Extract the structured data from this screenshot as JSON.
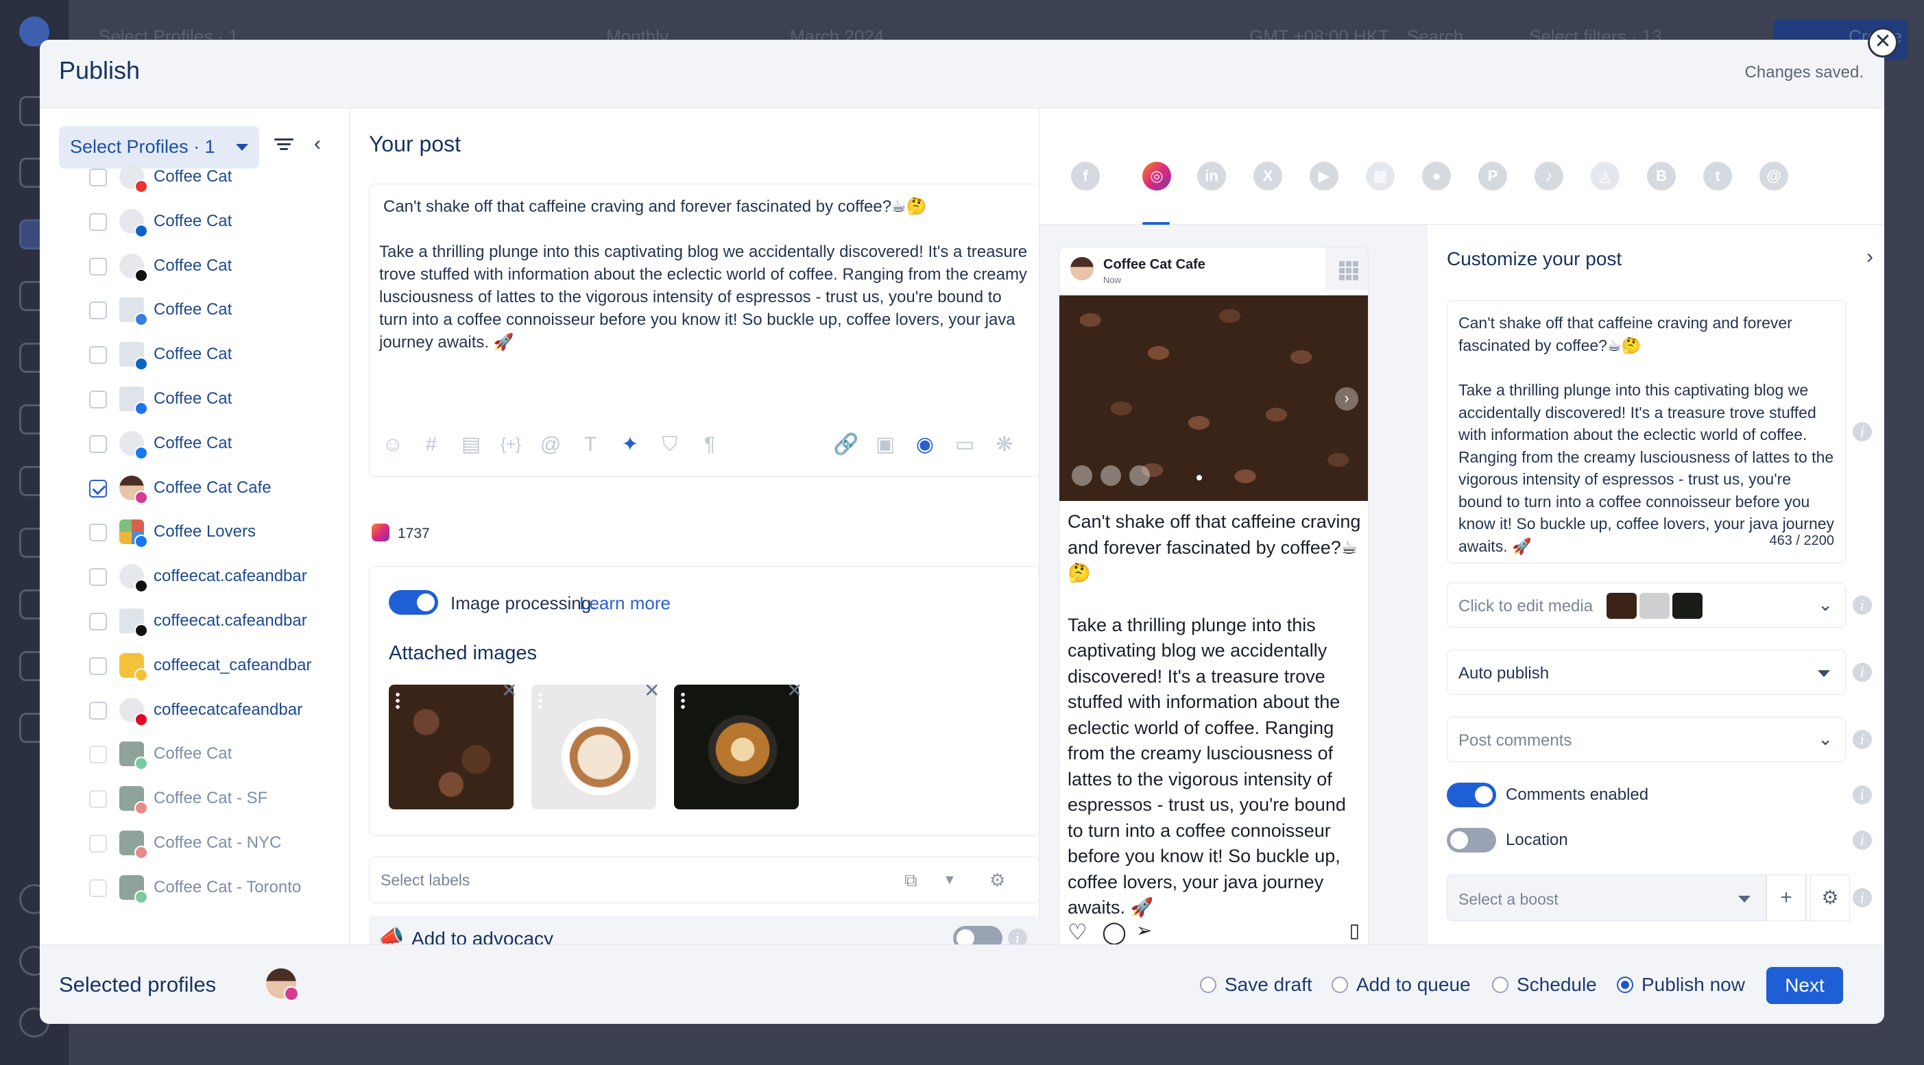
{
  "background": {
    "profiles_label": "Select Profiles · 1",
    "period": "Monthly",
    "month": "March 2024",
    "timezone": "GMT +08:00 HKT",
    "search": "Search",
    "filters": "Select filters · 13",
    "create": "Create"
  },
  "modal": {
    "title": "Publish",
    "status": "Changes saved.",
    "close_icon": "✕"
  },
  "profiles": {
    "select_label": "Select Profiles · 1",
    "items": [
      {
        "name": "Coffee Cat",
        "icon": "youtube",
        "badge_color": "#e5352e",
        "checked": false
      },
      {
        "name": "Coffee Cat",
        "icon": "linkedin",
        "badge_color": "#0a66c2",
        "checked": false
      },
      {
        "name": "Coffee Cat",
        "icon": "x",
        "badge_color": "#111111",
        "checked": false
      },
      {
        "name": "Coffee Cat",
        "icon": "google-business",
        "badge_color": "#3b7ddd",
        "checked": false
      },
      {
        "name": "Coffee Cat",
        "icon": "linkedin-page",
        "badge_color": "#0a66c2",
        "checked": false
      },
      {
        "name": "Coffee Cat",
        "icon": "bluesky",
        "badge_color": "#1d74e8",
        "checked": false
      },
      {
        "name": "Coffee Cat",
        "icon": "facebook",
        "badge_color": "#1877f2",
        "checked": false
      },
      {
        "name": "Coffee Cat Cafe",
        "icon": "instagram",
        "badge_color": "#d63b8f",
        "checked": true
      },
      {
        "name": "Coffee Lovers",
        "icon": "facebook",
        "badge_color": "#1877f2",
        "checked": false
      },
      {
        "name": "coffeecat.cafeandbar",
        "icon": "tiktok",
        "badge_color": "#111111",
        "checked": false
      },
      {
        "name": "coffeecat.cafeandbar",
        "icon": "threads",
        "badge_color": "#111111",
        "checked": false
      },
      {
        "name": "coffeecat_cafeandbar",
        "icon": "snapchat",
        "badge_color": "#f4c23a",
        "checked": false
      },
      {
        "name": "coffeecatcafeandbar",
        "icon": "pinterest",
        "badge_color": "#e60023",
        "checked": false
      },
      {
        "name": "Coffee Cat",
        "icon": "google-business",
        "badge_color": "#7ccaa0",
        "checked": false,
        "dim": true
      },
      {
        "name": "Coffee Cat - SF",
        "icon": "yelp",
        "badge_color": "#e88a8a",
        "checked": false,
        "dim": true
      },
      {
        "name": "Coffee Cat - NYC",
        "icon": "yelp",
        "badge_color": "#e88a8a",
        "checked": false,
        "dim": true
      },
      {
        "name": "Coffee Cat - Toronto",
        "icon": "google-business",
        "badge_color": "#7ccaa0",
        "checked": false,
        "dim": true
      }
    ]
  },
  "post": {
    "title": "Your post",
    "line1": "Can't shake off that caffeine craving and forever fascinated by coffee?☕🤔",
    "body": "Take a thrilling plunge into this captivating blog we accidentally discovered! It's a treasure trove stuffed with information about the eclectic world of coffee. Ranging from the creamy lusciousness of lattes to the vigorous intensity of espressos - trust us, you're bound to turn into a coffee connoisseur before you know it! So buckle up, coffee lovers, your java journey awaits. 🚀",
    "char_count": "1737",
    "image_processing_label": "Image processing.",
    "learn_more": "Learn more",
    "image_processing_on": true,
    "attached_title": "Attached images",
    "labels_placeholder": "Select labels",
    "advocacy_label": "Add to advocacy",
    "advocacy_on": false
  },
  "networks": [
    "facebook",
    "instagram",
    "linkedin",
    "x",
    "youtube",
    "google-business",
    "reddit",
    "pinterest",
    "tiktok",
    "snapchat",
    "bluesky",
    "tumblr",
    "threads"
  ],
  "active_network": "instagram",
  "preview": {
    "account": "Coffee Cat Cafe",
    "time": "Now",
    "text1": "Can't shake off that caffeine craving and forever fascinated by coffee?☕🤔",
    "text2": "Take a thrilling plunge into this captivating blog we accidentally discovered! It's a treasure trove stuffed with information about the eclectic world of coffee. Ranging from the creamy lusciousness of lattes to the vigorous intensity of espressos - trust us, you're bound to turn into a coffee connoisseur before you know it! So buckle up, coffee lovers, your java journey awaits. 🚀"
  },
  "customize": {
    "title": "Customize your post",
    "text1": "Can't shake off that caffeine craving and forever fascinated by coffee?☕🤔",
    "text2": "Take a thrilling plunge into this captivating blog we accidentally discovered! It's a treasure trove stuffed with information about the eclectic world of coffee. Ranging from the creamy lusciousness of lattes to the vigorous intensity of espressos - trust us, you're bound to turn into a coffee connoisseur before you know it! So buckle up, coffee lovers, your java journey awaits. 🚀",
    "count": "463 / 2200",
    "media_placeholder": "Click to edit media",
    "publish_mode": "Auto publish",
    "comments_placeholder": "Post comments",
    "comments_enabled_label": "Comments enabled",
    "comments_enabled": true,
    "location_label": "Location",
    "location_on": false,
    "boost_placeholder": "Select a boost"
  },
  "footer": {
    "selected_label": "Selected profiles",
    "options": [
      {
        "label": "Save draft",
        "selected": false
      },
      {
        "label": "Add to queue",
        "selected": false
      },
      {
        "label": "Schedule",
        "selected": false
      },
      {
        "label": "Publish now",
        "selected": true
      }
    ],
    "next_label": "Next"
  }
}
